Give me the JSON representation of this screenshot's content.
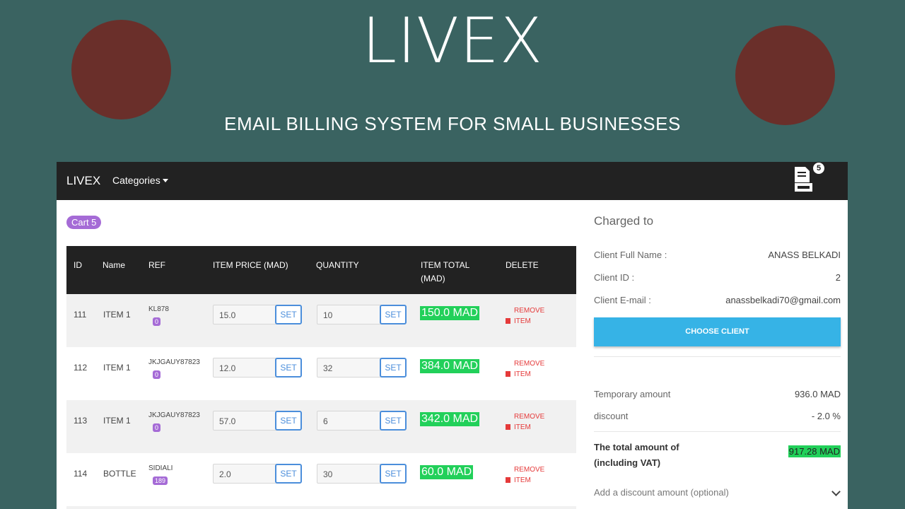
{
  "hero": {
    "title": "LIVEX",
    "subtitle": "EMAIL BILLING SYSTEM FOR SMALL BUSINESSES",
    "circle_color": "#6a2f2a",
    "bg_color": "#3a6361"
  },
  "navbar": {
    "brand": "LIVEX",
    "categories_label": "Categories",
    "invoice_count": "5"
  },
  "cart": {
    "label": "Cart 5"
  },
  "table": {
    "headers": {
      "id": "ID",
      "name": "Name",
      "ref": "REF",
      "price": "ITEM PRICE (MAD)",
      "quantity": "QUANTITY",
      "total": "ITEM TOTAL (MAD)",
      "delete": "DELETE"
    },
    "set_label": "SET",
    "remove_label": "REMOVE ITEM",
    "rows": [
      {
        "id": "111",
        "name": "ITEM 1",
        "ref": "KL878",
        "ref_badge": "0",
        "price": "15.0",
        "quantity": "10",
        "total": "150.0 MAD"
      },
      {
        "id": "112",
        "name": "ITEM 1",
        "ref": "JKJGAUY87823",
        "ref_badge": "0",
        "price": "12.0",
        "quantity": "32",
        "total": "384.0 MAD"
      },
      {
        "id": "113",
        "name": "ITEM 1",
        "ref": "JKJGAUY87823",
        "ref_badge": "0",
        "price": "57.0",
        "quantity": "6",
        "total": "342.0 MAD"
      },
      {
        "id": "114",
        "name": "BOTTLE",
        "ref": "SIDIALI",
        "ref_badge": "189",
        "price": "2.0",
        "quantity": "30",
        "total": "60.0 MAD"
      }
    ]
  },
  "side": {
    "charged_to": "Charged to",
    "client_name_label": "Client Full Name :",
    "client_name": "ANASS BELKADI",
    "client_id_label": "Client ID :",
    "client_id": "2",
    "client_email_label": "Client E-mail :",
    "client_email": "anassbelkadi70@gmail.com",
    "choose_client": "CHOOSE CLIENT",
    "temp_amount_label": "Temporary amount",
    "temp_amount": "936.0 MAD",
    "discount_label": "discount",
    "discount": "- 2.0 %",
    "total_label_1": "The total amount of",
    "total_label_2": "(including VAT)",
    "total": "917.28 MAD",
    "add_discount": "Add a discount amount (optional)"
  }
}
